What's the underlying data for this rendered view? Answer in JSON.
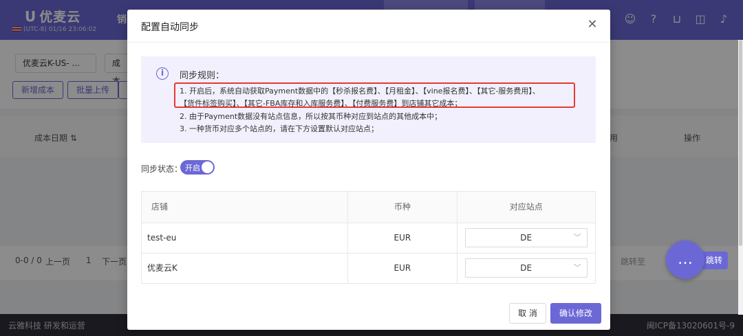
{
  "app": {
    "logo": "优麦云",
    "timezone": "(UTC-8) 01/16 23:06:02",
    "nav_fragment": "销"
  },
  "filters": {
    "store_select": "优麦云K-US- ...",
    "cost_select": "成本",
    "add_cost": "新增成本",
    "bulk_upload": "批量上传"
  },
  "bg_table": {
    "col_cost_date": "成本日期",
    "col_frag": "用",
    "col_action": "操作"
  },
  "pager": {
    "count": "0-0 / 0",
    "prev": "上一页",
    "page": "1",
    "next": "下一页",
    "jump_to": "跳转至",
    "jump_btn": "跳转"
  },
  "footer": {
    "left": "云雅科技 研发和运营",
    "right": "闽ICP备13020601号-9"
  },
  "modal": {
    "title": "配置自动同步",
    "rules_title": "同步规则：",
    "rule_1a": "1. 开启后，系统自动获取Payment数据中的【秒杀报名费】、【月租金】、【vine报名费】、【其它-服务费用】、",
    "rule_1b": "【货件标签购买】、【其它-FBA库存和入库服务费】、【付费服务费】到店铺其它成本；",
    "rule_2": "2. 由于Payment数据没有站点信息，所以按其币种对应到站点的其他成本中；",
    "rule_3": "3. 一种货币对应多个站点的，请在下方设置默认对应站点；",
    "sync_status_label": "同步状态：",
    "toggle_label": "开启",
    "table": {
      "headers": [
        "店铺",
        "币种",
        "对应站点"
      ],
      "rows": [
        {
          "store": "test-eu",
          "currency": "EUR",
          "site": "DE"
        },
        {
          "store": "优麦云K",
          "currency": "EUR",
          "site": "DE"
        }
      ]
    },
    "cancel": "取 消",
    "confirm": "确认修改"
  },
  "colors": {
    "primary": "#6b68d6",
    "highlight_border": "#e53935",
    "info_bg": "#f1f0fc"
  }
}
